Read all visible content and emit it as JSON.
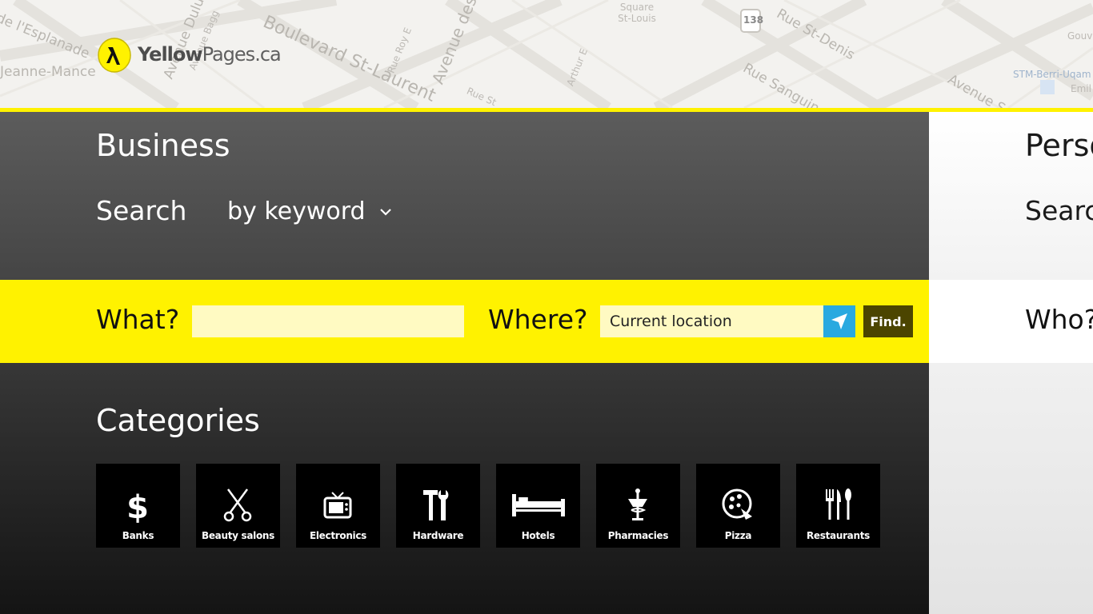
{
  "map": {
    "labels": [
      "de l'Esplanade",
      "Jeanne-Mance",
      "Avenue Duluth",
      "Avenue Bagg",
      "Boulevard St-Laurent",
      "Rue Roy E",
      "Avenue des",
      "Rue St",
      "Square St-Louis",
      "138",
      "Rue St-Denis",
      "Rue Sanguinet",
      "Avenue Sav",
      "STM-Berri-Uqam",
      "Emil",
      "Gouv",
      "Arthur E"
    ]
  },
  "logo": {
    "word1": "Yellow",
    "word2": "Pages",
    "suffix": ".ca"
  },
  "business": {
    "title": "Business",
    "search_label": "Search",
    "search_mode": "by keyword",
    "what_label": "What?",
    "what_value": "",
    "where_label": "Where?",
    "where_value": "Current location",
    "find_label": "Find.",
    "categories_title": "Categories",
    "categories": [
      {
        "label": "Banks",
        "icon": "dollar-icon"
      },
      {
        "label": "Beauty salons",
        "icon": "scissors-icon"
      },
      {
        "label": "Electronics",
        "icon": "tv-icon"
      },
      {
        "label": "Hardware",
        "icon": "tools-icon"
      },
      {
        "label": "Hotels",
        "icon": "bed-icon"
      },
      {
        "label": "Pharmacies",
        "icon": "pharmacy-icon"
      },
      {
        "label": "Pizza",
        "icon": "pizza-icon"
      },
      {
        "label": "Restaurants",
        "icon": "cutlery-icon"
      }
    ]
  },
  "personal": {
    "title": "Perso",
    "search_label": "Searc",
    "who_label": "Who?"
  },
  "colors": {
    "brand_yellow": "#fff200",
    "location_blue": "#29a9e0",
    "find_button": "#4c4500"
  }
}
